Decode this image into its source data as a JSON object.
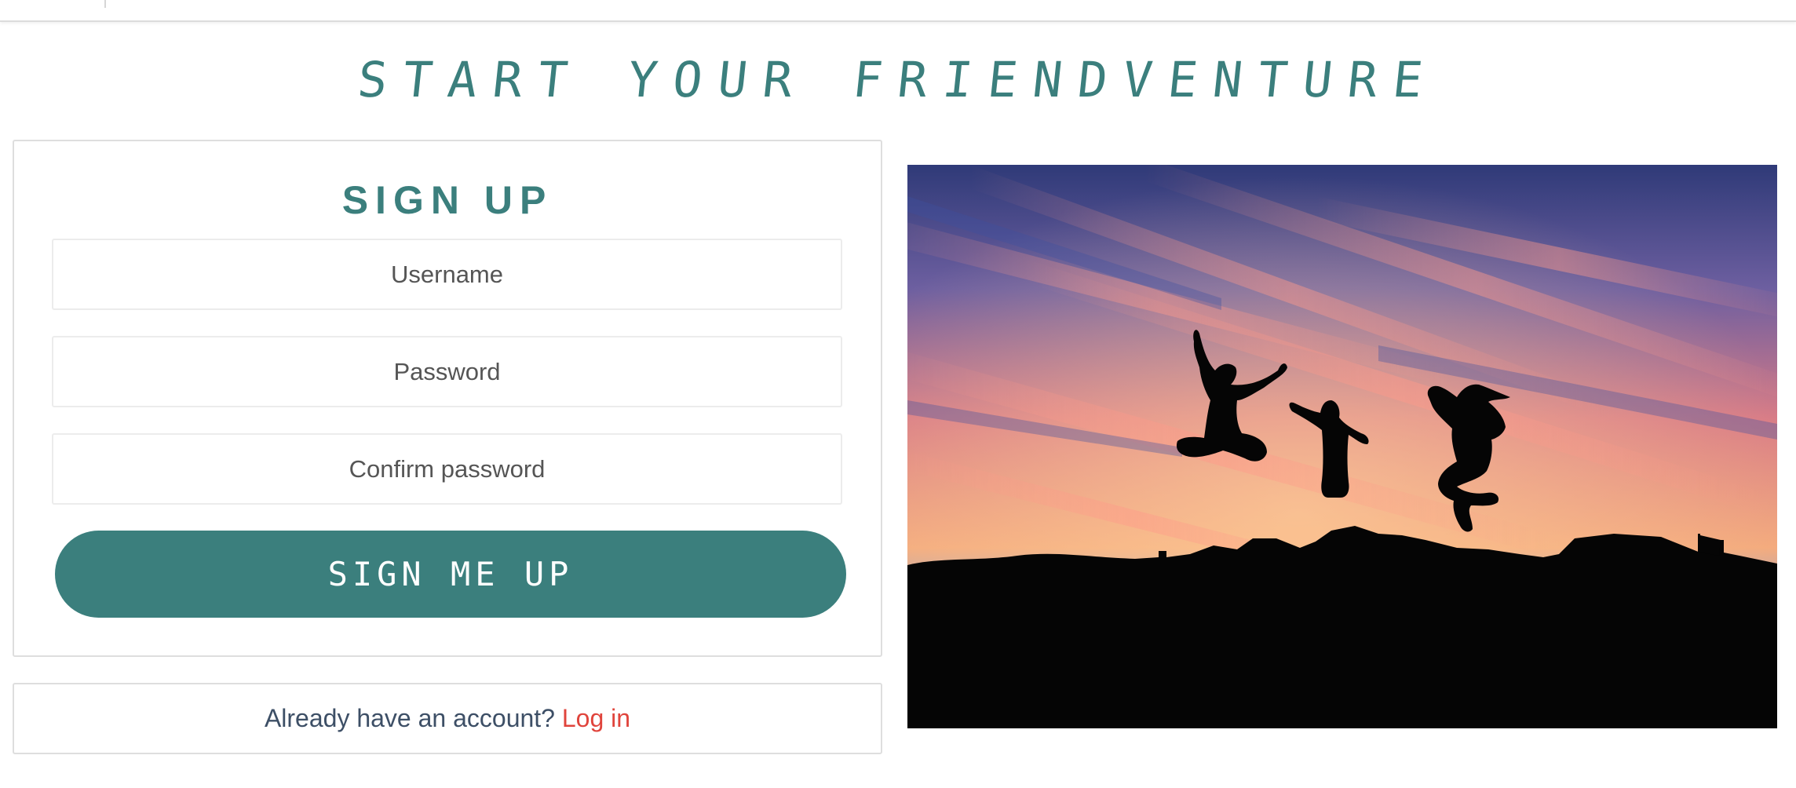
{
  "headline": "START YOUR FRIENDVENTURE",
  "signup": {
    "title": "SIGN UP",
    "username_placeholder": "Username",
    "password_placeholder": "Password",
    "confirm_placeholder": "Confirm password",
    "submit_label": "SIGN ME UP"
  },
  "login_prompt": {
    "text": "Already have an account?",
    "link_label": "Log in"
  },
  "colors": {
    "accent": "#3b7f7d",
    "link": "#e0443c",
    "text": "#3d4f66"
  },
  "hero": {
    "subject": "three friends jumping silhouetted against a sunset sky"
  }
}
